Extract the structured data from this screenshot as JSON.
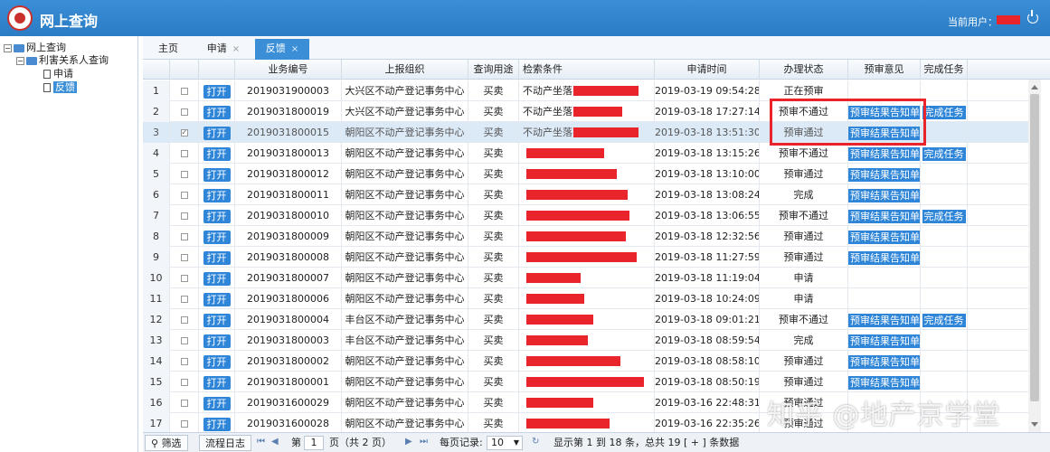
{
  "app": {
    "title": "网上查询",
    "user_label": "当前用户："
  },
  "sidebar": {
    "root": "网上查询",
    "group": "利害关系人查询",
    "items": [
      "申请",
      "反馈"
    ]
  },
  "tabs": [
    {
      "label": "主页"
    },
    {
      "label": "申请",
      "close": "×"
    },
    {
      "label": "反馈",
      "close": "×"
    }
  ],
  "table": {
    "headers": [
      "业务编号",
      "上报组织",
      "查询用途",
      "检索条件",
      "申请时间",
      "办理状态",
      "预审意见",
      "完成任务"
    ],
    "open_label": "打开",
    "opinion_label": "预审结果告知单",
    "complete_label": "完成任务",
    "rows": [
      {
        "num": "1",
        "id": "2019031900003",
        "org": "大兴区不动产登记事务中心",
        "use": "买卖",
        "cond": "不动产坐落:",
        "time": "2019-03-19 09:54:28",
        "status": "正在预审",
        "opinion": false,
        "done": false
      },
      {
        "num": "2",
        "id": "2019031800019",
        "org": "大兴区不动产登记事务中心",
        "use": "买卖",
        "cond": "不动产坐落:",
        "time": "2019-03-18 17:27:14",
        "status": "预审不通过",
        "opinion": true,
        "done": true
      },
      {
        "num": "3",
        "id": "2019031800015",
        "org": "朝阳区不动产登记事务中心",
        "use": "买卖",
        "cond": "不动产坐落:",
        "time": "2019-03-18 13:51:30",
        "status": "预审通过",
        "opinion": true,
        "done": false
      },
      {
        "num": "4",
        "id": "2019031800013",
        "org": "朝阳区不动产登记事务中心",
        "use": "买卖",
        "cond": "",
        "time": "2019-03-18 13:15:26",
        "status": "预审不通过",
        "opinion": true,
        "done": true
      },
      {
        "num": "5",
        "id": "2019031800012",
        "org": "朝阳区不动产登记事务中心",
        "use": "买卖",
        "cond": "",
        "time": "2019-03-18 13:10:00",
        "status": "预审通过",
        "opinion": true,
        "done": false
      },
      {
        "num": "6",
        "id": "2019031800011",
        "org": "朝阳区不动产登记事务中心",
        "use": "买卖",
        "cond": "",
        "time": "2019-03-18 13:08:24",
        "status": "完成",
        "opinion": true,
        "done": false
      },
      {
        "num": "7",
        "id": "2019031800010",
        "org": "朝阳区不动产登记事务中心",
        "use": "买卖",
        "cond": "",
        "time": "2019-03-18 13:06:55",
        "status": "预审不通过",
        "opinion": true,
        "done": true
      },
      {
        "num": "8",
        "id": "2019031800009",
        "org": "朝阳区不动产登记事务中心",
        "use": "买卖",
        "cond": "",
        "time": "2019-03-18 12:32:56",
        "status": "预审通过",
        "opinion": true,
        "done": false
      },
      {
        "num": "9",
        "id": "2019031800008",
        "org": "朝阳区不动产登记事务中心",
        "use": "买卖",
        "cond": "",
        "time": "2019-03-18 11:27:59",
        "status": "预审通过",
        "opinion": true,
        "done": false
      },
      {
        "num": "10",
        "id": "2019031800007",
        "org": "朝阳区不动产登记事务中心",
        "use": "买卖",
        "cond": "",
        "time": "2019-03-18 11:19:04",
        "status": "申请",
        "opinion": false,
        "done": false
      },
      {
        "num": "11",
        "id": "2019031800006",
        "org": "朝阳区不动产登记事务中心",
        "use": "买卖",
        "cond": "",
        "time": "2019-03-18 10:24:09",
        "status": "申请",
        "opinion": false,
        "done": false
      },
      {
        "num": "12",
        "id": "2019031800004",
        "org": "丰台区不动产登记事务中心",
        "use": "买卖",
        "cond": "",
        "time": "2019-03-18 09:01:21",
        "status": "预审不通过",
        "opinion": true,
        "done": true
      },
      {
        "num": "13",
        "id": "2019031800003",
        "org": "丰台区不动产登记事务中心",
        "use": "买卖",
        "cond": "",
        "time": "2019-03-18 08:59:54",
        "status": "完成",
        "opinion": true,
        "done": false
      },
      {
        "num": "14",
        "id": "2019031800002",
        "org": "朝阳区不动产登记事务中心",
        "use": "买卖",
        "cond": "",
        "time": "2019-03-18 08:58:10",
        "status": "预审通过",
        "opinion": true,
        "done": false
      },
      {
        "num": "15",
        "id": "2019031800001",
        "org": "朝阳区不动产登记事务中心",
        "use": "买卖",
        "cond": "",
        "time": "2019-03-18 08:50:19",
        "status": "预审通过",
        "opinion": true,
        "done": false
      },
      {
        "num": "16",
        "id": "2019031600029",
        "org": "朝阳区不动产登记事务中心",
        "use": "买卖",
        "cond": "",
        "time": "2019-03-16 22:48:31",
        "status": "预审通过",
        "opinion": false,
        "done": false
      },
      {
        "num": "17",
        "id": "2019031600028",
        "org": "朝阳区不动产登记事务中心",
        "use": "买卖",
        "cond": "",
        "time": "2019-03-16 22:35:26",
        "status": "预审通过",
        "opinion": false,
        "done": false
      }
    ],
    "selected_row": 3
  },
  "footer": {
    "filter": "筛选",
    "log": "流程日志",
    "page_prefix": "第",
    "page_value": "1",
    "page_suffix": "页（共 2 页）",
    "per_page_label": "每页记录:",
    "per_page_value": "10",
    "summary": "显示第 1 到 18 条，总共 19 [ + ] 条数据"
  },
  "watermark": "知乎 @地产京学堂",
  "colors": {
    "header_blue": "#2a7cc4",
    "button_blue": "#2f86d9",
    "annotation_red": "#e9242b"
  }
}
